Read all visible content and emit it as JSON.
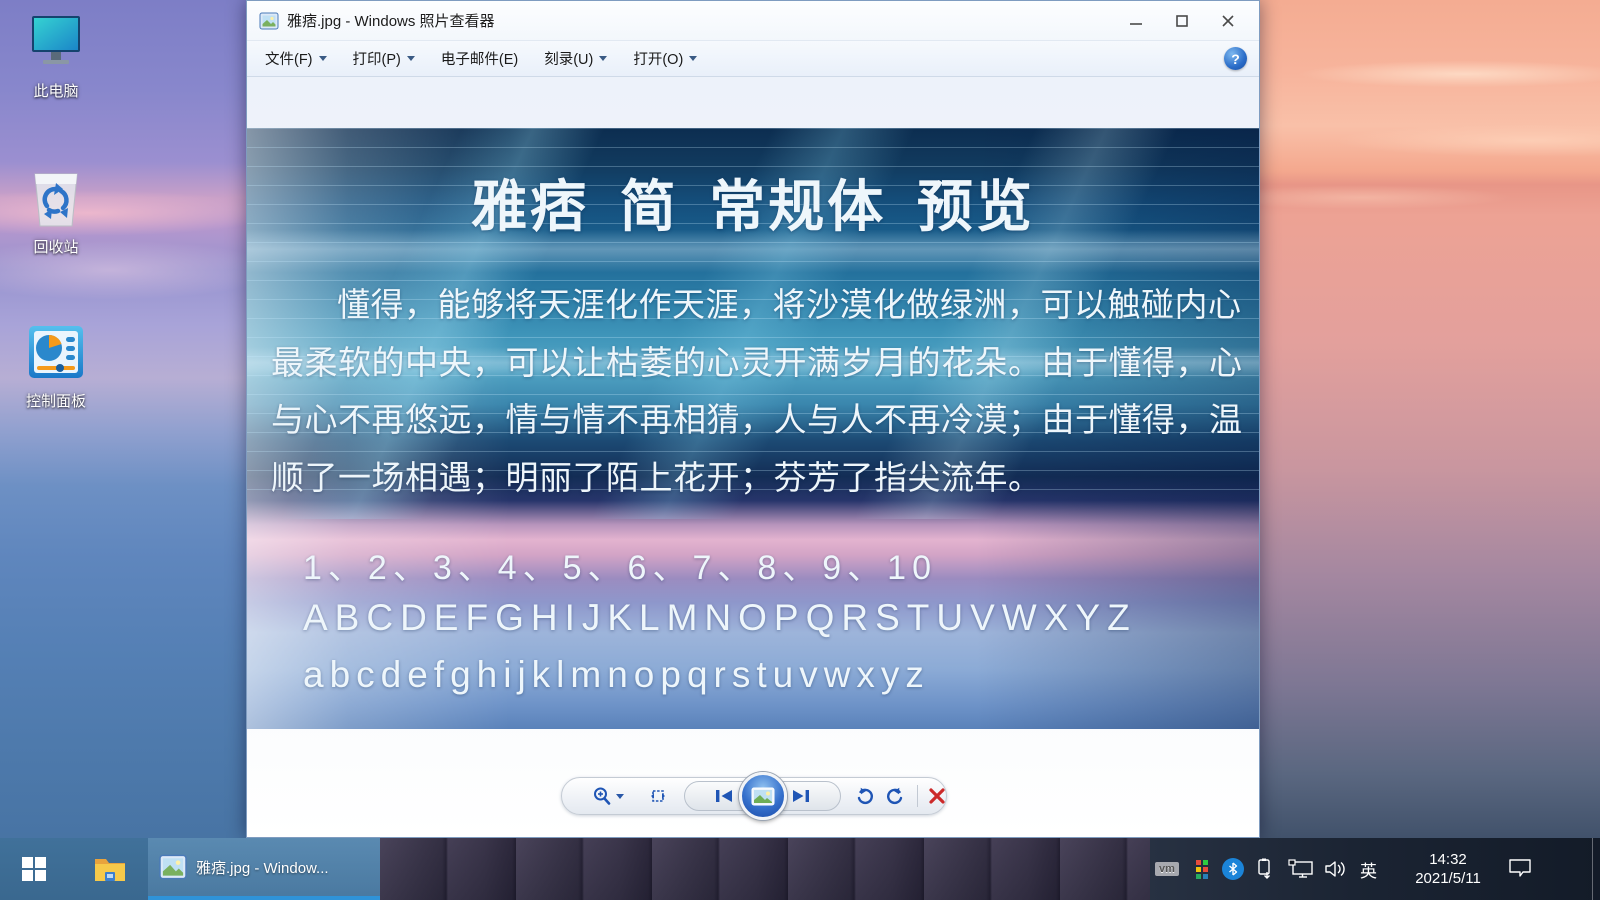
{
  "desktop": {
    "icons": [
      {
        "label": "此电脑"
      },
      {
        "label": "回收站"
      },
      {
        "label": "控制面板"
      }
    ]
  },
  "window": {
    "title": "雅痞.jpg - Windows 照片查看器",
    "menu": [
      {
        "label": "文件(F)"
      },
      {
        "label": "打印(P)"
      },
      {
        "label": "电子邮件(E)"
      },
      {
        "label": "刻录(U)"
      },
      {
        "label": "打开(O)"
      }
    ],
    "help_glyph": "?"
  },
  "photo": {
    "heading": "雅痞 简 常规体 预览",
    "lines": [
      "懂得，能够将天涯化作天涯，将沙漠化做绿洲，可以触碰内心",
      "最柔软的中央，可以让枯萎的心灵开满岁月的花朵。由于懂得，心",
      "与心不再悠远，情与情不再相猜，人与人不再冷漠；由于懂得，温",
      "顺了一场相遇；明丽了陌上花开；芬芳了指尖流年。"
    ],
    "numbers": "1、2、3、4、5、6、7、8、9、10",
    "uppercase": "ABCDEFGHIJKLMNOPQRSTUVWXYZ",
    "lowercase": "abcdefghijklmnopqrstuvwxyz"
  },
  "taskbar": {
    "app_label": "雅痞.jpg - Window...",
    "tray": {
      "vm": "vm",
      "ime": "英",
      "time": "14:32",
      "date": "2021/5/11"
    }
  },
  "colors": {
    "accent_blue": "#2f93d8",
    "toolbar_icon_blue": "#1f55b5",
    "delete_red": "#cc2a2a",
    "bluetooth_blue": "#1b84d8"
  }
}
